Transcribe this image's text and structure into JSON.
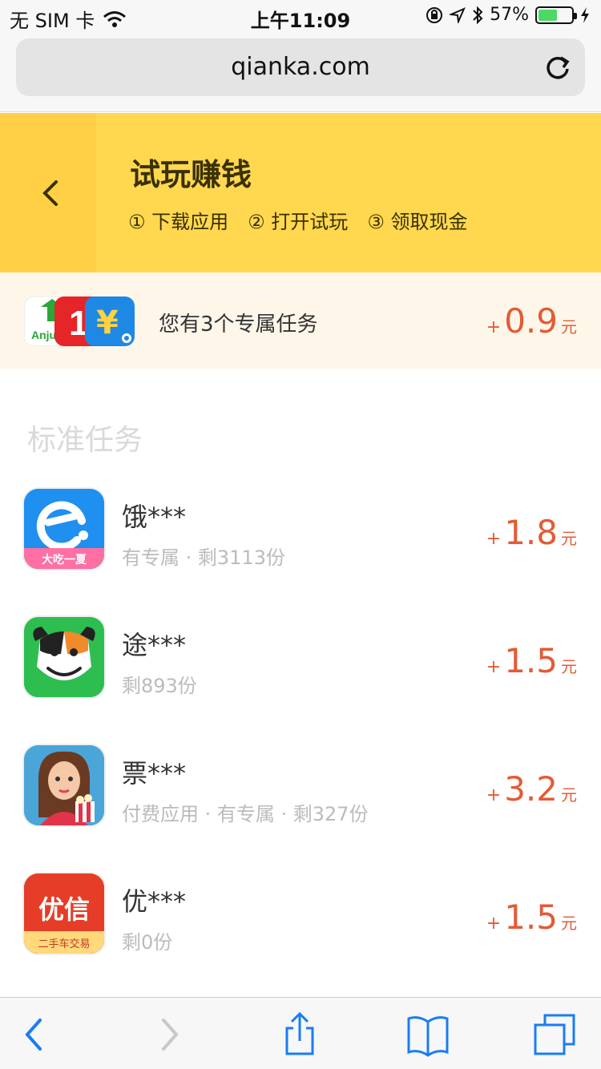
{
  "status_bar": {
    "carrier": "无 SIM 卡",
    "time": "上午11:09",
    "battery_percent": "57%",
    "battery_level": 0.57
  },
  "browser": {
    "url": "qianka.com"
  },
  "header": {
    "title": "试玩赚钱",
    "steps": [
      "① 下载应用",
      "② 打开试玩",
      "③ 领取现金"
    ]
  },
  "exclusive": {
    "text": "您有3个专属任务",
    "reward_sign": "+",
    "reward_amount": "0.9",
    "reward_unit": "元",
    "icons": [
      {
        "name": "anjuke-app-icon",
        "label": "Anju",
        "color": "#ffffff"
      },
      {
        "name": "red-one-app-icon",
        "label": "1",
        "color": "#e52528"
      },
      {
        "name": "blue-yen-app-icon",
        "label": "¥",
        "color": "#1e88e5"
      }
    ]
  },
  "section_title": "标准任务",
  "tasks": [
    {
      "name": "饿***",
      "meta": "有专属 · 剩3113份",
      "sign": "+",
      "amount": "1.8",
      "unit": "元",
      "icon": "eleme-app-icon",
      "icon_caption": "大吃一夏",
      "icon_color": "#2196f3"
    },
    {
      "name": "途***",
      "meta": "剩893份",
      "sign": "+",
      "amount": "1.5",
      "unit": "元",
      "icon": "tuniu-cow-app-icon",
      "icon_color": "#2dbe4f"
    },
    {
      "name": "票***",
      "meta": "付费应用 · 有专属 · 剩327份",
      "sign": "+",
      "amount": "3.2",
      "unit": "元",
      "icon": "movie-girl-app-icon",
      "icon_color": "#4aa6d8"
    },
    {
      "name": "优***",
      "meta": "剩0份",
      "sign": "+",
      "amount": "1.5",
      "unit": "元",
      "icon": "youxin-app-icon",
      "icon_label": "优信",
      "icon_caption": "二手车交易",
      "icon_color": "#e53d27"
    }
  ],
  "colors": {
    "banner": "#ffd84f",
    "reward": "#e35b36",
    "ios_blue": "#1a7cf6"
  }
}
